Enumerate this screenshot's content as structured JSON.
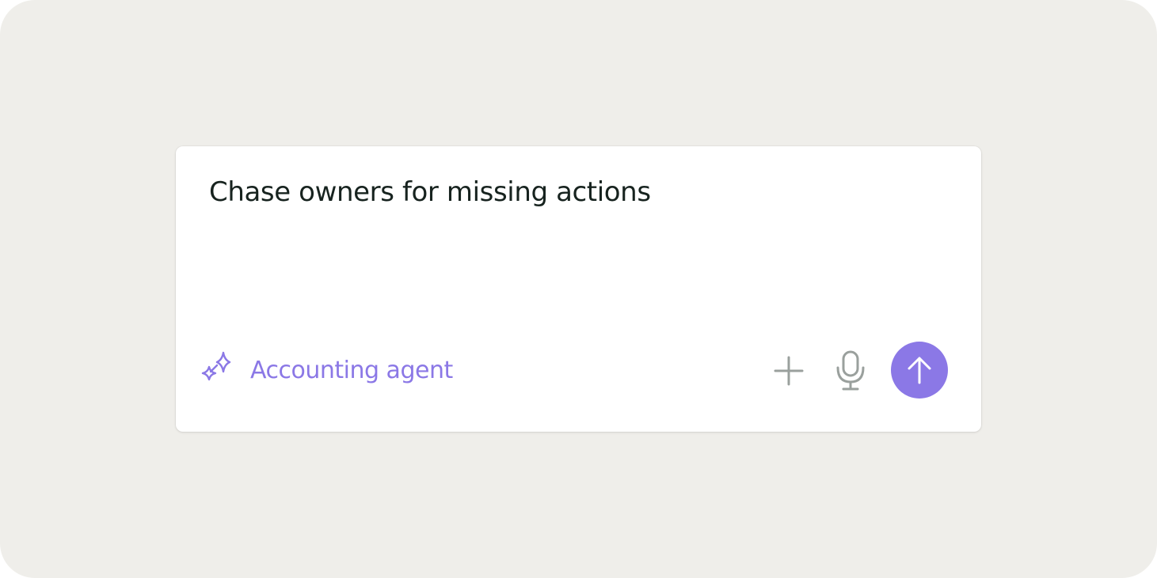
{
  "composer": {
    "prompt_text": "Chase owners for missing actions",
    "agent": {
      "label": "Accounting agent",
      "icon": "sparkle-icon"
    },
    "actions": {
      "attach_icon": "plus-icon",
      "voice_icon": "microphone-icon",
      "send_icon": "arrow-up-icon"
    }
  },
  "colors": {
    "background": "#efeeea",
    "card": "#ffffff",
    "accent": "#8b78e6",
    "text": "#17231f",
    "icon_muted": "#9aa09d"
  }
}
